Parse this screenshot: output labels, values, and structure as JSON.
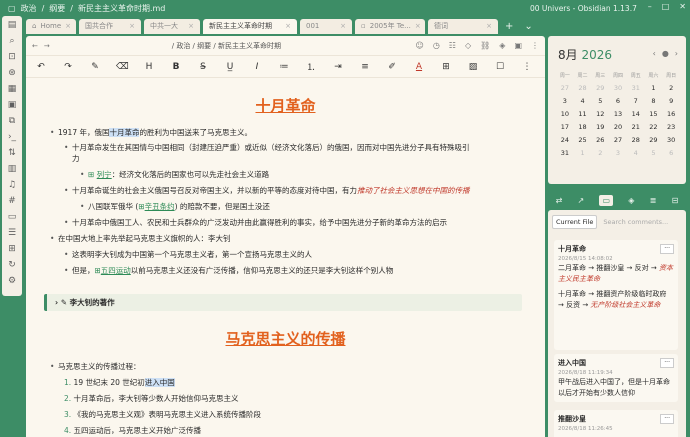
{
  "window": {
    "breadcrumb": [
      "政治",
      "纲要",
      "新民主主义革命时期.md"
    ],
    "title": "00 Univers - Obsidian 1.13.7"
  },
  "tabs": [
    {
      "label": "Home",
      "active": false
    },
    {
      "label": "国共合作",
      "active": false
    },
    {
      "label": "中共一大",
      "active": false
    },
    {
      "label": "新民主主义革命时期",
      "active": true
    },
    {
      "label": "001",
      "active": false
    },
    {
      "label": "2005年 Te...",
      "active": false
    },
    {
      "label": "德词",
      "active": false
    }
  ],
  "nav": {
    "breadcrumb": "/ 政治 / 纲要 / 新民主主义革命时期"
  },
  "doc": {
    "h1": "十月革命",
    "l1a": "1917 年，俄国",
    "l1b": "十月革命",
    "l1c": "的胜利为中国送来了马克思主义。",
    "l2": "十月革命发生在其国情与中国相同（封建压迫严重）或近似（经济文化落后）的俄国，因而对中国先进分子具有特殊吸引",
    "l2b": "力",
    "l3a": "列宁",
    "l3b": "：经济文化落后的国家也可以先走社会主义道路",
    "l4a": "十月革命诞生的社会主义俄国号召反对帝国主义，并以新的平等的态度对待中国，有力",
    "l4b": "推动了社会主义思想在中国的传播",
    "l5a": "八国联军俄华 (",
    "l5b": "辛丑条约",
    "l5c": ") 的赔款不要，但是国土没还",
    "l6": "十月革命中俄国工人、农民和士兵群众的广泛发动并由此赢得胜利的事实，给予中国先进分子新的革命方法的启示",
    "l7": "在中国大地上率先举起马克思主义旗帜的人：李大钊",
    "l8": "这表明李大钊成为中国第一个马克思主义者，第一个宣扬马克思主义的人",
    "l9a": "但是，",
    "l9b": "五四运动",
    "l9c": "以前马克思主义还没有广泛传播，信仰马克思主义的还只是李大钊这样个别人物",
    "callout": "李大钊的著作",
    "h2": "马克思主义的传播",
    "l10": "马克思主义的传播过程：",
    "o1a": "19 世纪末 20 世纪初",
    "o1b": "进入中国",
    "o2": "十月革命后，李大钊等少数人开始信仰马克思主义",
    "o3": "《我的马克思主义观》表明马克思主义进入系统传播阶段",
    "o4": "五四运动后，马克思主义开始广泛传播"
  },
  "calendar": {
    "month": "8月",
    "year": "2026",
    "weekdays": [
      "周一",
      "周二",
      "周三",
      "周四",
      "周五",
      "周六",
      "周日"
    ],
    "days": [
      [
        "27",
        "28",
        "29",
        "30",
        "31",
        "1",
        "2"
      ],
      [
        "3",
        "4",
        "5",
        "6",
        "7",
        "8",
        "9"
      ],
      [
        "10",
        "11",
        "12",
        "13",
        "14",
        "15",
        "16"
      ],
      [
        "17",
        "18",
        "19",
        "20",
        "21",
        "22",
        "23"
      ],
      [
        "24",
        "25",
        "26",
        "27",
        "28",
        "29",
        "30"
      ],
      [
        "31",
        "1",
        "2",
        "3",
        "4",
        "5",
        "6"
      ]
    ]
  },
  "comments_panel": {
    "current_file": "Current File",
    "search_placeholder": "Search comments...",
    "items": [
      {
        "title": "十月革命",
        "date": "2026/8/15 14:08:02",
        "text_a": "二月革命 → 推翻沙皇 → 反对 → ",
        "text_b": "资本主义民主革命",
        "text_c": "十月革命 → 推翻资产阶级临时政府 → 反资 → ",
        "text_d": "无产阶级社会主义革命"
      },
      {
        "title": "进入中国",
        "date": "2026/8/18 11:19:34",
        "text_a": "甲午战后进入中国了，但是十月革命以后才开始有少数人信仰"
      },
      {
        "title": "推翻沙皇",
        "date": "2026/8/18 11:26:45"
      }
    ]
  }
}
